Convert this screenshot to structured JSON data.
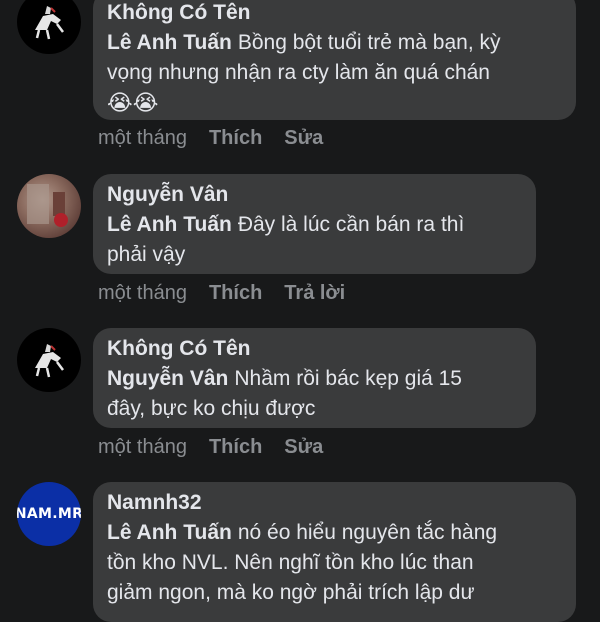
{
  "comments": [
    {
      "author": "Không Có Tên",
      "mention": "Lê Anh Tuấn",
      "text_line1": "Bồng bột tuổi trẻ mà bạn, kỳ",
      "text_line2": "vọng nhưng nhận ra cty làm ăn quá chán",
      "emojis": "😭😭",
      "time": "một tháng",
      "like": "Thích",
      "action": "Sửa",
      "avatar_icon": "horse-rider-icon"
    },
    {
      "author": "Nguyễn Vân",
      "mention": "Lê Anh Tuấn",
      "text_line1": "Đây là lúc cần bán ra thì",
      "text_line2": "phải vậy",
      "time": "một tháng",
      "like": "Thích",
      "action": "Trả lời",
      "avatar_icon": "user-photo-icon"
    },
    {
      "author": "Không Có Tên",
      "mention": "Nguyễn Vân",
      "text_line1": "Nhầm rồi bác kẹp giá 15",
      "text_line2": "đây, bực ko chịu được",
      "time": "một tháng",
      "like": "Thích",
      "action": "Sửa",
      "avatar_icon": "horse-rider-icon"
    },
    {
      "author": "Namnh32",
      "mention": "Lê Anh Tuấn",
      "text_line1": "nó éo hiểu nguyên tắc hàng",
      "text_line2": "tồn kho NVL. Nên nghĩ tồn kho lúc than",
      "text_line3": "giảm ngon, mà ko ngờ phải trích lập dư",
      "avatar_text": "NAM.MR"
    }
  ],
  "colors": {
    "background": "#18191a",
    "bubble": "#3a3b3c",
    "text": "#e4e6eb",
    "muted": "#8a8d91",
    "brand_avatar": "#0b2fa6"
  }
}
